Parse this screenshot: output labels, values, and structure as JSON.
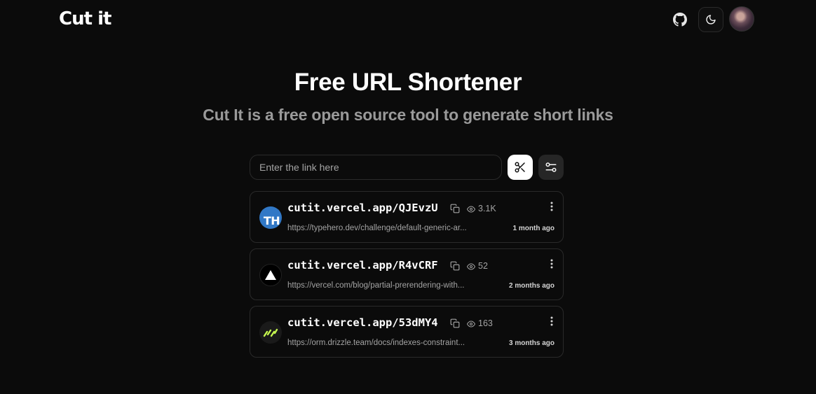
{
  "header": {
    "logo": "Cut it",
    "github_icon": "github-icon",
    "theme_icon": "moon-icon"
  },
  "hero": {
    "title": "Free URL Shortener",
    "subtitle": "Cut It is a free open source tool to generate short links"
  },
  "form": {
    "input_placeholder": "Enter the link here",
    "input_value": "",
    "cut_icon": "scissors-icon",
    "settings_icon": "sliders-icon"
  },
  "links": [
    {
      "short_url": "cutit.vercel.app/QJEvzU",
      "views": "3.1K",
      "original_url": "https://typehero.dev/challenge/default-generic-ar...",
      "time": "1 month ago",
      "favicon": "typehero-icon",
      "favicon_text": "TH"
    },
    {
      "short_url": "cutit.vercel.app/R4vCRF",
      "views": "52",
      "original_url": "https://vercel.com/blog/partial-prerendering-with...",
      "time": "2 months ago",
      "favicon": "vercel-icon"
    },
    {
      "short_url": "cutit.vercel.app/53dMY4",
      "views": "163",
      "original_url": "https://orm.drizzle.team/docs/indexes-constraint...",
      "time": "3 months ago",
      "favicon": "drizzle-icon"
    }
  ],
  "colors": {
    "background": "#0b0b0b",
    "text": "#fafafa",
    "muted": "#a3a3a3",
    "border": "#2a2a2a",
    "typehero_blue": "#3178c6",
    "drizzle_green": "#c5f74f"
  }
}
